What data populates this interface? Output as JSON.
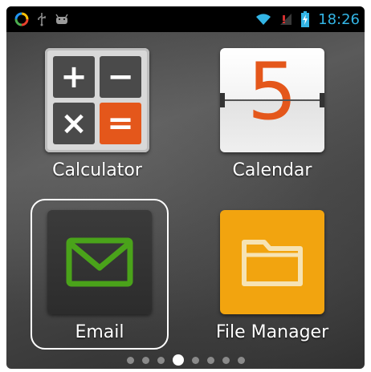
{
  "status_bar": {
    "time": "18:26",
    "left_icons": [
      "colorful-circle-app-icon",
      "usb-icon",
      "android-icon"
    ],
    "right_icons": [
      "wifi-icon",
      "signal-icon",
      "battery-icon"
    ],
    "clock_color": "#33b5e5"
  },
  "apps": [
    {
      "label": "Calculator",
      "icon": "calculator-icon"
    },
    {
      "label": "Calendar",
      "icon": "calendar-icon",
      "day": "5"
    },
    {
      "label": "Email",
      "icon": "envelope-icon"
    },
    {
      "label": "File Manager",
      "icon": "folder-icon"
    }
  ],
  "calculator_keys": [
    "+",
    "−",
    "×",
    "="
  ],
  "page_indicator": {
    "total": 8,
    "active": 3
  },
  "colors": {
    "accent_orange": "#e4571b",
    "email_green": "#4aa31a",
    "folder_orange": "#f2a40f"
  }
}
